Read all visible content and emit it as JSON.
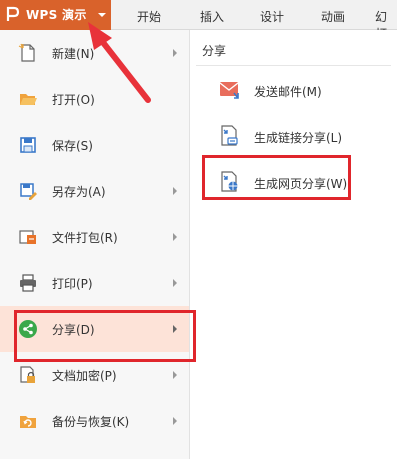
{
  "app": {
    "title": "WPS 演示",
    "accent": "#d9622b"
  },
  "tabs": [
    "开始",
    "插入",
    "设计",
    "动画",
    "幻灯"
  ],
  "menu": [
    {
      "label": "新建(N)",
      "icon": "new-file-icon",
      "has_submenu": true
    },
    {
      "label": "打开(O)",
      "icon": "open-folder-icon",
      "has_submenu": false
    },
    {
      "label": "保存(S)",
      "icon": "save-disk-icon",
      "has_submenu": false
    },
    {
      "label": "另存为(A)",
      "icon": "save-as-icon",
      "has_submenu": true
    },
    {
      "label": "文件打包(R)",
      "icon": "package-icon",
      "has_submenu": true
    },
    {
      "label": "打印(P)",
      "icon": "printer-icon",
      "has_submenu": true
    },
    {
      "label": "分享(D)",
      "icon": "share-icon",
      "has_submenu": true,
      "active": true
    },
    {
      "label": "文档加密(P)",
      "icon": "lock-document-icon",
      "has_submenu": true
    },
    {
      "label": "备份与恢复(K)",
      "icon": "backup-restore-icon",
      "has_submenu": true
    }
  ],
  "submenu": {
    "title": "分享",
    "items": [
      {
        "label": "发送邮件(M)",
        "icon": "mail-icon"
      },
      {
        "label": "生成链接分享(L)",
        "icon": "link-share-icon"
      },
      {
        "label": "生成网页分享(W)",
        "icon": "web-share-icon"
      }
    ]
  },
  "colors": {
    "highlight_box": "#e0262c",
    "active_row": "#fde3d8",
    "annotation_arrow": "#e8323a"
  }
}
